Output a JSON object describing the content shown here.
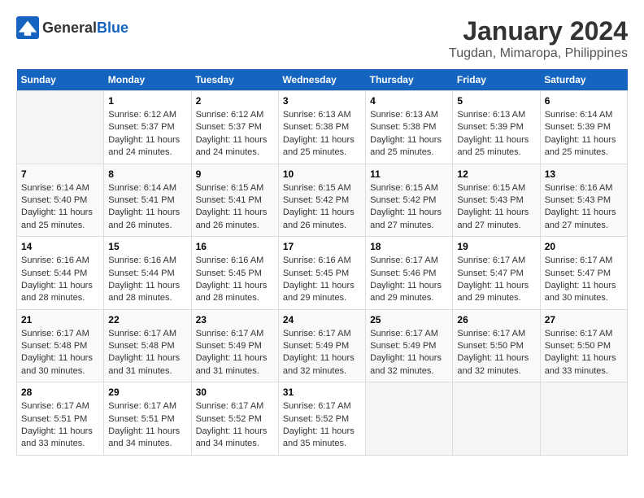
{
  "logo": {
    "general": "General",
    "blue": "Blue"
  },
  "title": "January 2024",
  "subtitle": "Tugdan, Mimaropa, Philippines",
  "days_header": [
    "Sunday",
    "Monday",
    "Tuesday",
    "Wednesday",
    "Thursday",
    "Friday",
    "Saturday"
  ],
  "weeks": [
    [
      {
        "day": "",
        "info": ""
      },
      {
        "day": "1",
        "info": "Sunrise: 6:12 AM\nSunset: 5:37 PM\nDaylight: 11 hours\nand 24 minutes."
      },
      {
        "day": "2",
        "info": "Sunrise: 6:12 AM\nSunset: 5:37 PM\nDaylight: 11 hours\nand 24 minutes."
      },
      {
        "day": "3",
        "info": "Sunrise: 6:13 AM\nSunset: 5:38 PM\nDaylight: 11 hours\nand 25 minutes."
      },
      {
        "day": "4",
        "info": "Sunrise: 6:13 AM\nSunset: 5:38 PM\nDaylight: 11 hours\nand 25 minutes."
      },
      {
        "day": "5",
        "info": "Sunrise: 6:13 AM\nSunset: 5:39 PM\nDaylight: 11 hours\nand 25 minutes."
      },
      {
        "day": "6",
        "info": "Sunrise: 6:14 AM\nSunset: 5:39 PM\nDaylight: 11 hours\nand 25 minutes."
      }
    ],
    [
      {
        "day": "7",
        "info": "Sunrise: 6:14 AM\nSunset: 5:40 PM\nDaylight: 11 hours\nand 25 minutes."
      },
      {
        "day": "8",
        "info": "Sunrise: 6:14 AM\nSunset: 5:41 PM\nDaylight: 11 hours\nand 26 minutes."
      },
      {
        "day": "9",
        "info": "Sunrise: 6:15 AM\nSunset: 5:41 PM\nDaylight: 11 hours\nand 26 minutes."
      },
      {
        "day": "10",
        "info": "Sunrise: 6:15 AM\nSunset: 5:42 PM\nDaylight: 11 hours\nand 26 minutes."
      },
      {
        "day": "11",
        "info": "Sunrise: 6:15 AM\nSunset: 5:42 PM\nDaylight: 11 hours\nand 27 minutes."
      },
      {
        "day": "12",
        "info": "Sunrise: 6:15 AM\nSunset: 5:43 PM\nDaylight: 11 hours\nand 27 minutes."
      },
      {
        "day": "13",
        "info": "Sunrise: 6:16 AM\nSunset: 5:43 PM\nDaylight: 11 hours\nand 27 minutes."
      }
    ],
    [
      {
        "day": "14",
        "info": "Sunrise: 6:16 AM\nSunset: 5:44 PM\nDaylight: 11 hours\nand 28 minutes."
      },
      {
        "day": "15",
        "info": "Sunrise: 6:16 AM\nSunset: 5:44 PM\nDaylight: 11 hours\nand 28 minutes."
      },
      {
        "day": "16",
        "info": "Sunrise: 6:16 AM\nSunset: 5:45 PM\nDaylight: 11 hours\nand 28 minutes."
      },
      {
        "day": "17",
        "info": "Sunrise: 6:16 AM\nSunset: 5:45 PM\nDaylight: 11 hours\nand 29 minutes."
      },
      {
        "day": "18",
        "info": "Sunrise: 6:17 AM\nSunset: 5:46 PM\nDaylight: 11 hours\nand 29 minutes."
      },
      {
        "day": "19",
        "info": "Sunrise: 6:17 AM\nSunset: 5:47 PM\nDaylight: 11 hours\nand 29 minutes."
      },
      {
        "day": "20",
        "info": "Sunrise: 6:17 AM\nSunset: 5:47 PM\nDaylight: 11 hours\nand 30 minutes."
      }
    ],
    [
      {
        "day": "21",
        "info": "Sunrise: 6:17 AM\nSunset: 5:48 PM\nDaylight: 11 hours\nand 30 minutes."
      },
      {
        "day": "22",
        "info": "Sunrise: 6:17 AM\nSunset: 5:48 PM\nDaylight: 11 hours\nand 31 minutes."
      },
      {
        "day": "23",
        "info": "Sunrise: 6:17 AM\nSunset: 5:49 PM\nDaylight: 11 hours\nand 31 minutes."
      },
      {
        "day": "24",
        "info": "Sunrise: 6:17 AM\nSunset: 5:49 PM\nDaylight: 11 hours\nand 32 minutes."
      },
      {
        "day": "25",
        "info": "Sunrise: 6:17 AM\nSunset: 5:49 PM\nDaylight: 11 hours\nand 32 minutes."
      },
      {
        "day": "26",
        "info": "Sunrise: 6:17 AM\nSunset: 5:50 PM\nDaylight: 11 hours\nand 32 minutes."
      },
      {
        "day": "27",
        "info": "Sunrise: 6:17 AM\nSunset: 5:50 PM\nDaylight: 11 hours\nand 33 minutes."
      }
    ],
    [
      {
        "day": "28",
        "info": "Sunrise: 6:17 AM\nSunset: 5:51 PM\nDaylight: 11 hours\nand 33 minutes."
      },
      {
        "day": "29",
        "info": "Sunrise: 6:17 AM\nSunset: 5:51 PM\nDaylight: 11 hours\nand 34 minutes."
      },
      {
        "day": "30",
        "info": "Sunrise: 6:17 AM\nSunset: 5:52 PM\nDaylight: 11 hours\nand 34 minutes."
      },
      {
        "day": "31",
        "info": "Sunrise: 6:17 AM\nSunset: 5:52 PM\nDaylight: 11 hours\nand 35 minutes."
      },
      {
        "day": "",
        "info": ""
      },
      {
        "day": "",
        "info": ""
      },
      {
        "day": "",
        "info": ""
      }
    ]
  ]
}
